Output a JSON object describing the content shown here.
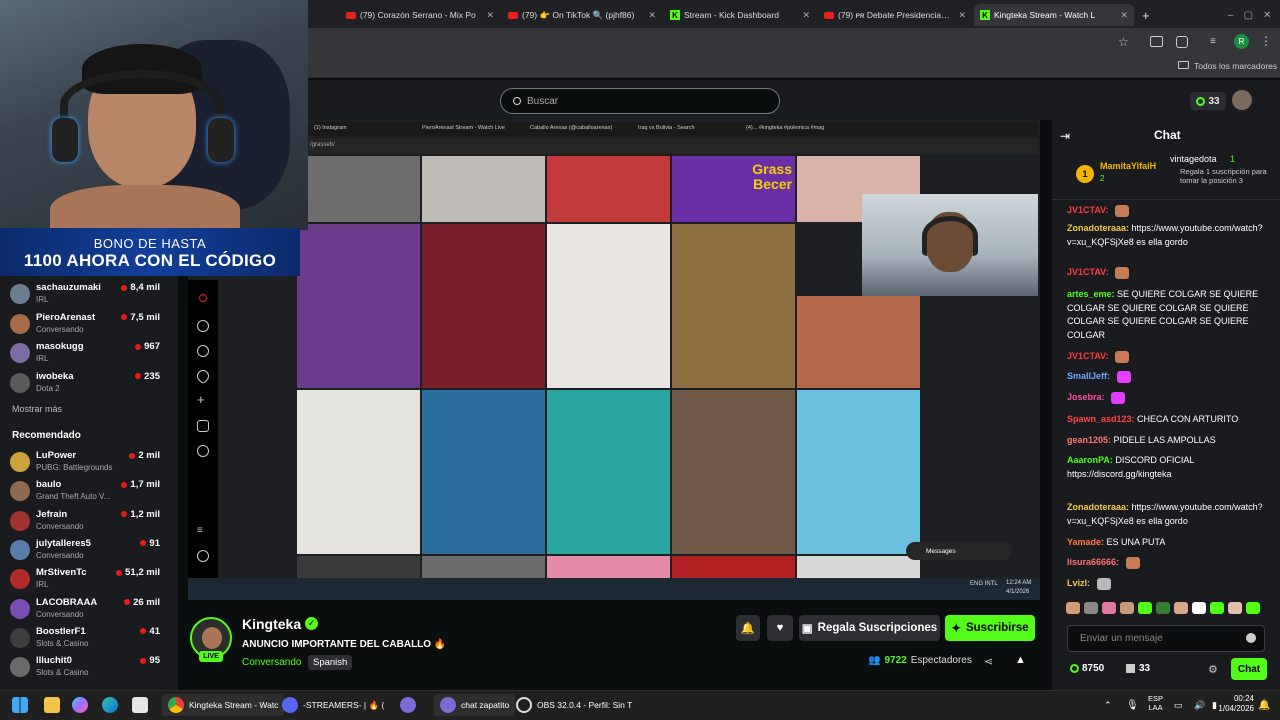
{
  "browser": {
    "tabs": [
      {
        "label": "(79) Corazón Serrano - Mix Po",
        "favicon": "youtube-icon"
      },
      {
        "label": "(79) 👉 On TikTok 🔍 (pjhf86)",
        "favicon": "youtube-icon"
      },
      {
        "label": "Stream - Kick Dashboard",
        "favicon": "kick-icon"
      },
      {
        "label": "(79) ᴘʀ Debate Presidencial 202",
        "favicon": "youtube-icon"
      },
      {
        "label": "Kingteka Stream - Watch L",
        "favicon": "kick-icon",
        "active": true
      }
    ],
    "bookmarks_label": "Todos los marcadores",
    "profile_initial": "R"
  },
  "kick": {
    "search_placeholder": "Buscar",
    "points": "33"
  },
  "overlay": {
    "banner_line1": "BONO DE HASTA",
    "banner_line2": "1100 AHORA CON EL CÓDIGO"
  },
  "sidebar": {
    "following": [
      {
        "name": "sachauzumaki",
        "category": "IRL",
        "viewers": "8,4 mil",
        "color": "#6b7d8f"
      },
      {
        "name": "PieroArenast",
        "category": "Conversando",
        "viewers": "7,5 mil",
        "color": "#a56b4a"
      },
      {
        "name": "masokugg",
        "category": "IRL",
        "viewers": "967",
        "color": "#7c6aa3"
      },
      {
        "name": "iwobeka",
        "category": "Dota 2",
        "viewers": "235",
        "color": "#5a5a5a"
      }
    ],
    "show_more": "Mostrar más",
    "recommended_title": "Recomendado",
    "recommended": [
      {
        "name": "LuPower",
        "category": "PUBG: Battlegrounds",
        "viewers": "2 mil",
        "color": "#c9a43a"
      },
      {
        "name": "baulo",
        "category": "Grand Theft Auto V...",
        "viewers": "1,7 mil",
        "color": "#8c6b52"
      },
      {
        "name": "Jefrain",
        "category": "Conversando",
        "viewers": "1,2 mil",
        "color": "#a13333"
      },
      {
        "name": "julytalleres5",
        "category": "Conversando",
        "viewers": "91",
        "color": "#5c7ca8"
      },
      {
        "name": "MrStivenTc",
        "category": "IRL",
        "viewers": "51,2 mil",
        "color": "#b02a2a"
      },
      {
        "name": "LACOBRAAA",
        "category": "Conversando",
        "viewers": "26 mil",
        "color": "#7a4fb3"
      },
      {
        "name": "BoostlerF1",
        "category": "Slots & Casino",
        "viewers": "41",
        "color": "#3d3d3d"
      },
      {
        "name": "llluchit0",
        "category": "Slots & Casino",
        "viewers": "95",
        "color": "#6a6a6a"
      }
    ]
  },
  "video": {
    "inner_tabs": [
      "(1) Instagram",
      "PieroArenast Stream - Watch Live",
      "Caballo Arenas (@caballoarenas)",
      "Iraq vs Bolivia - Search",
      "(4)... #kingteka #polemica #mag"
    ],
    "inner_url": "/grasseb/",
    "messages_label": "Messages",
    "tile_label": "Grass Becer",
    "taskbar_time": "12:24 AM",
    "taskbar_date": "4/1/2026",
    "taskbar_lang": "ENG INTL"
  },
  "stream": {
    "streamer": "Kingteka",
    "live_badge": "LIVE",
    "title": "ANUNCIO IMPORTANTE DEL CABALLO 🔥",
    "category": "Conversando",
    "language_tag": "Spanish",
    "gift_button": "Regala Suscripciones",
    "subscribe_button": "Suscribirse",
    "viewers": "9722",
    "viewers_label": "Espectadores"
  },
  "chat": {
    "title": "Chat",
    "pinned_user1": "MamitaYifaiH",
    "pinned_user1_count": "2",
    "pinned_user2": "vintagedota",
    "pinned_user2_count": "1",
    "pinned_text": "Regala 1 suscripción para tomar la posición 3",
    "messages": [
      {
        "user": "JV1CTAV:",
        "text": "",
        "color": "#ff3b3b"
      },
      {
        "user": "Zonadoteraaa:",
        "text": "https://www.youtube.com/watch?v=xu_KQFSjXe8 es ella gordo",
        "color": "#f2c94c"
      },
      {
        "user": "JV1CTAV:",
        "text": "",
        "color": "#ff3b3b"
      },
      {
        "user": "artes_eme:",
        "text": "SE QUIERE COLGAR SE QUIERE COLGAR SE QUIERE COLGAR SE QUIERE COLGAR SE QUIERE COLGAR SE QUIERE COLGAR",
        "color": "#53fc18"
      },
      {
        "user": "JV1CTAV:",
        "text": "",
        "color": "#ff3b3b"
      },
      {
        "user": "SmallJeff:",
        "text": "",
        "color": "#6fa8ff"
      },
      {
        "user": "Josebra:",
        "text": "",
        "color": "#ff4da6"
      },
      {
        "user": "Spawn_asd123:",
        "text": "CHECA CON ARTURITO",
        "color": "#ff4444"
      },
      {
        "user": "gean1205:",
        "text": "PIDELE LAS AMPOLLAS",
        "color": "#ff7272"
      },
      {
        "user": "AaaronPA:",
        "text": "DISCORD OFICIAL https://discord.gg/kingteka",
        "color": "#53fc18"
      },
      {
        "user": "Zonadoteraaa:",
        "text": "https://www.youtube.com/watch?v=xu_KQFSjXe8 es ella gordo",
        "color": "#f2c94c"
      },
      {
        "user": "Yamade:",
        "text": "ES UNA PUTA",
        "color": "#ff7a3d"
      },
      {
        "user": "lisura66666:",
        "text": "",
        "color": "#ff7272"
      },
      {
        "user": "Lvizl:",
        "text": "",
        "color": "#f2c94c"
      }
    ],
    "input_placeholder": "Enviar un mensaje",
    "points_balance": "8750",
    "gift_count": "33",
    "send_button": "Chat"
  },
  "windows_taskbar": {
    "items": [
      "Kingteka Stream - Watc",
      "-STREAMERS- | 🔥 (",
      "chat zapatito",
      "OBS 32.0.4 - Perfil: Sin T"
    ],
    "lang_line1": "ESP",
    "lang_line2": "LAA",
    "time": "00:24",
    "date": "1/04/2026"
  },
  "colors": {
    "kick_green": "#53fc18",
    "background": "#0b0e0f",
    "panel": "#191b1f"
  }
}
